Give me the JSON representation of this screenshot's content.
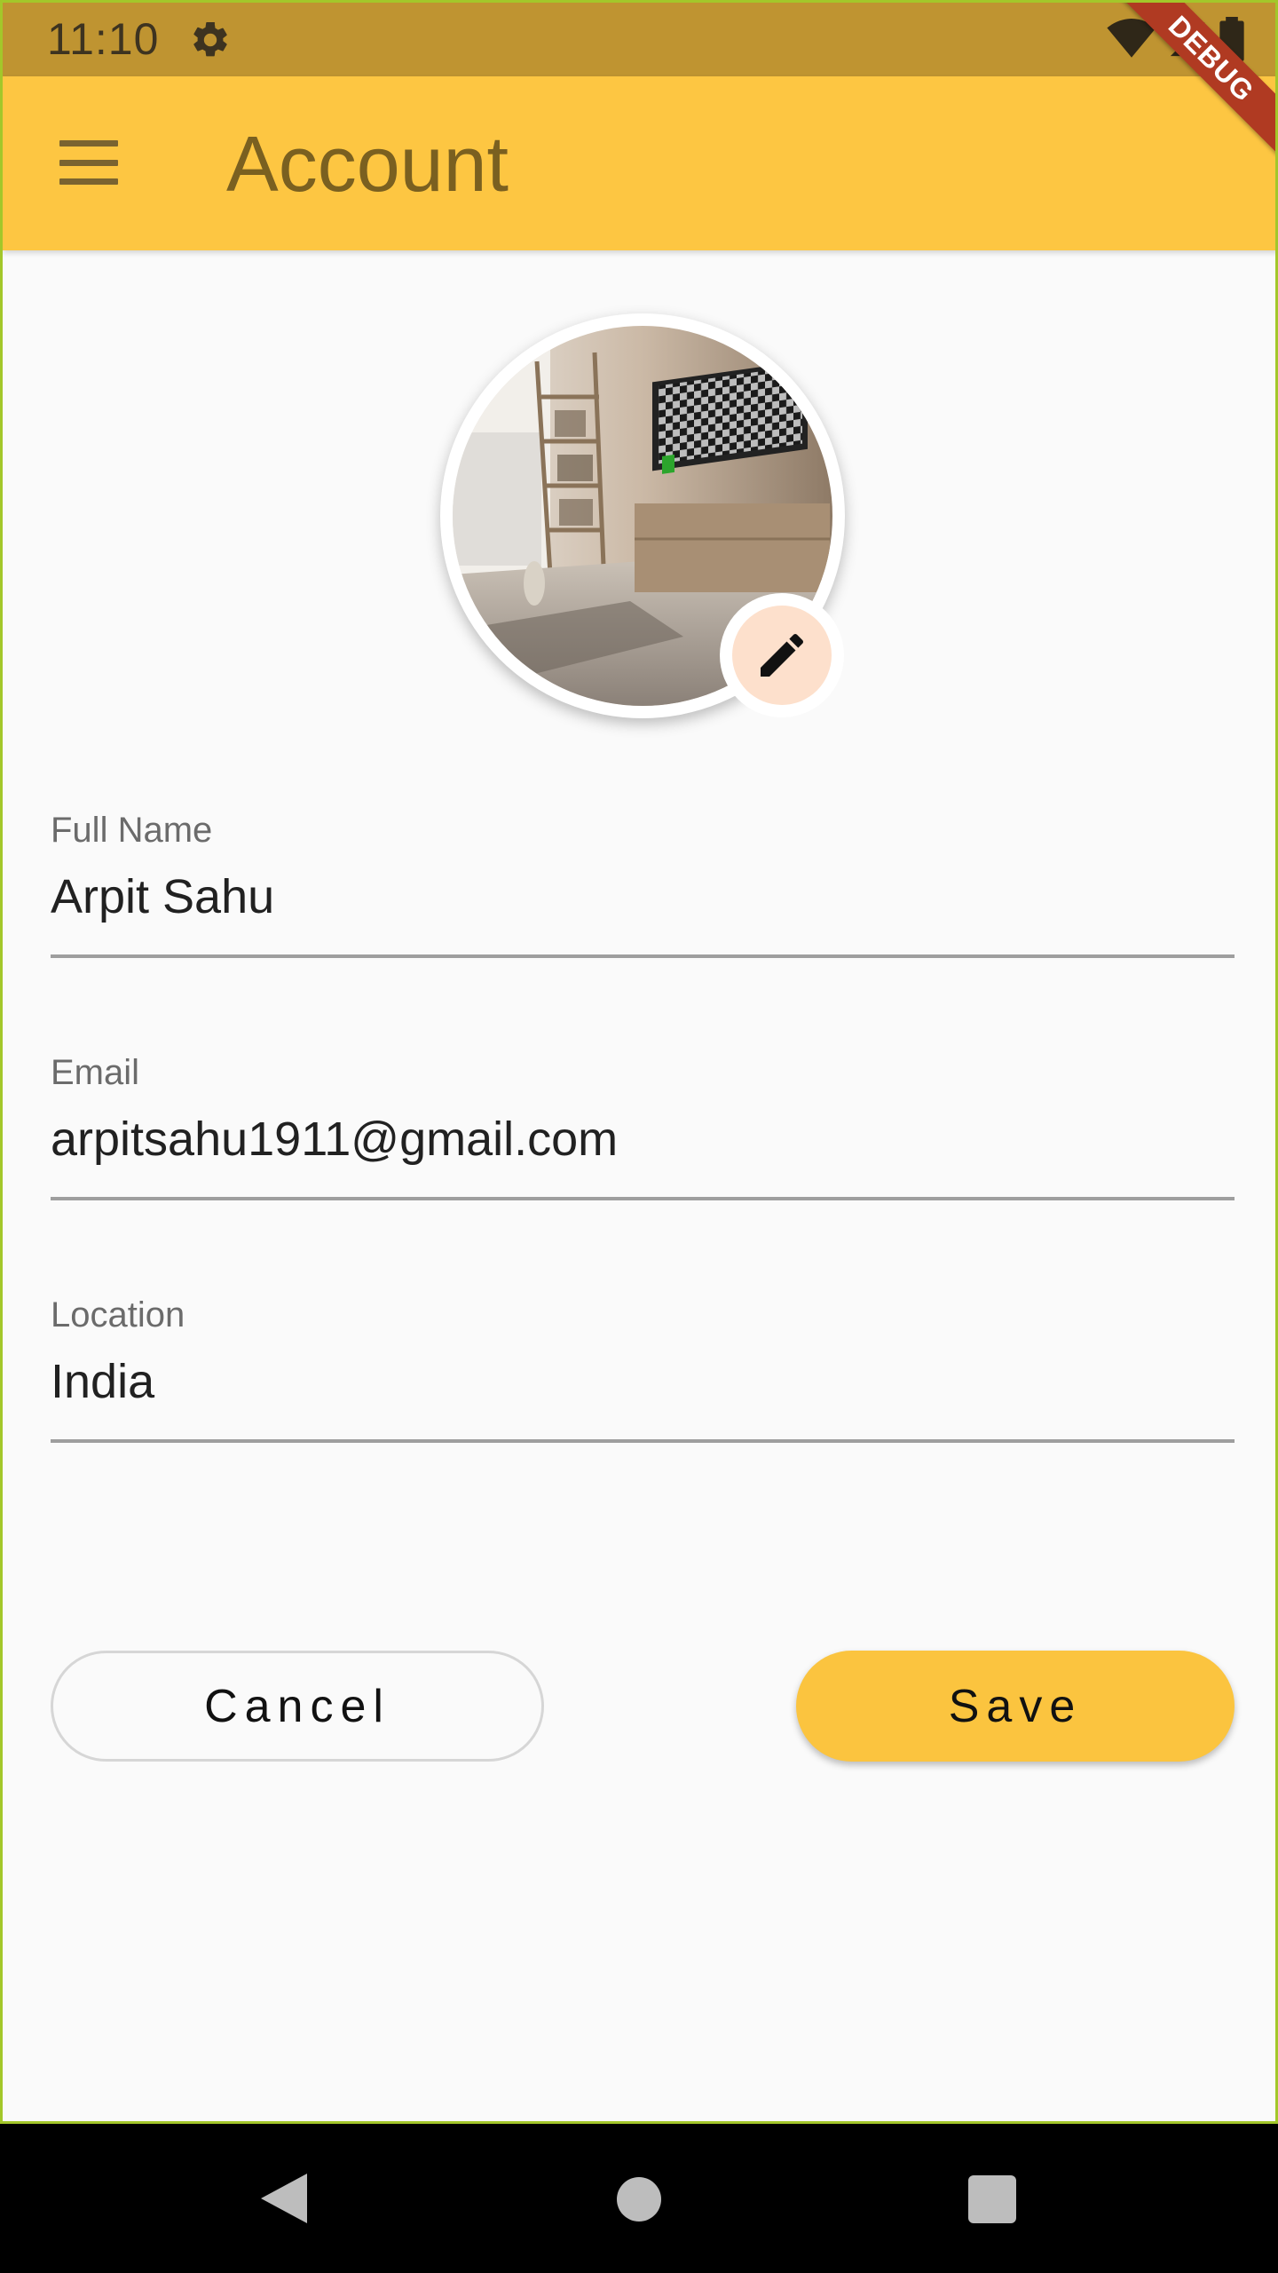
{
  "status_bar": {
    "time": "11:10",
    "icons": [
      "gear-icon",
      "wifi-icon",
      "signal-icon",
      "battery-icon"
    ]
  },
  "debug_banner": "DEBUG",
  "app_bar": {
    "title": "Account",
    "menu_icon": "menu-icon"
  },
  "profile": {
    "edit_icon": "pencil-icon"
  },
  "fields": [
    {
      "label": "Full Name",
      "value": "Arpit Sahu"
    },
    {
      "label": "Email",
      "value": "arpitsahu1911@gmail.com"
    },
    {
      "label": "Location",
      "value": "India"
    }
  ],
  "buttons": {
    "cancel": "Cancel",
    "save": "Save"
  },
  "colors": {
    "app_bar": "#fdc642",
    "status_bar": "#bf9431",
    "save_button": "#fbc43f",
    "edit_badge": "#fde0cc"
  },
  "nav_bar": {
    "icons": [
      "back-icon",
      "home-icon",
      "recents-icon"
    ]
  }
}
